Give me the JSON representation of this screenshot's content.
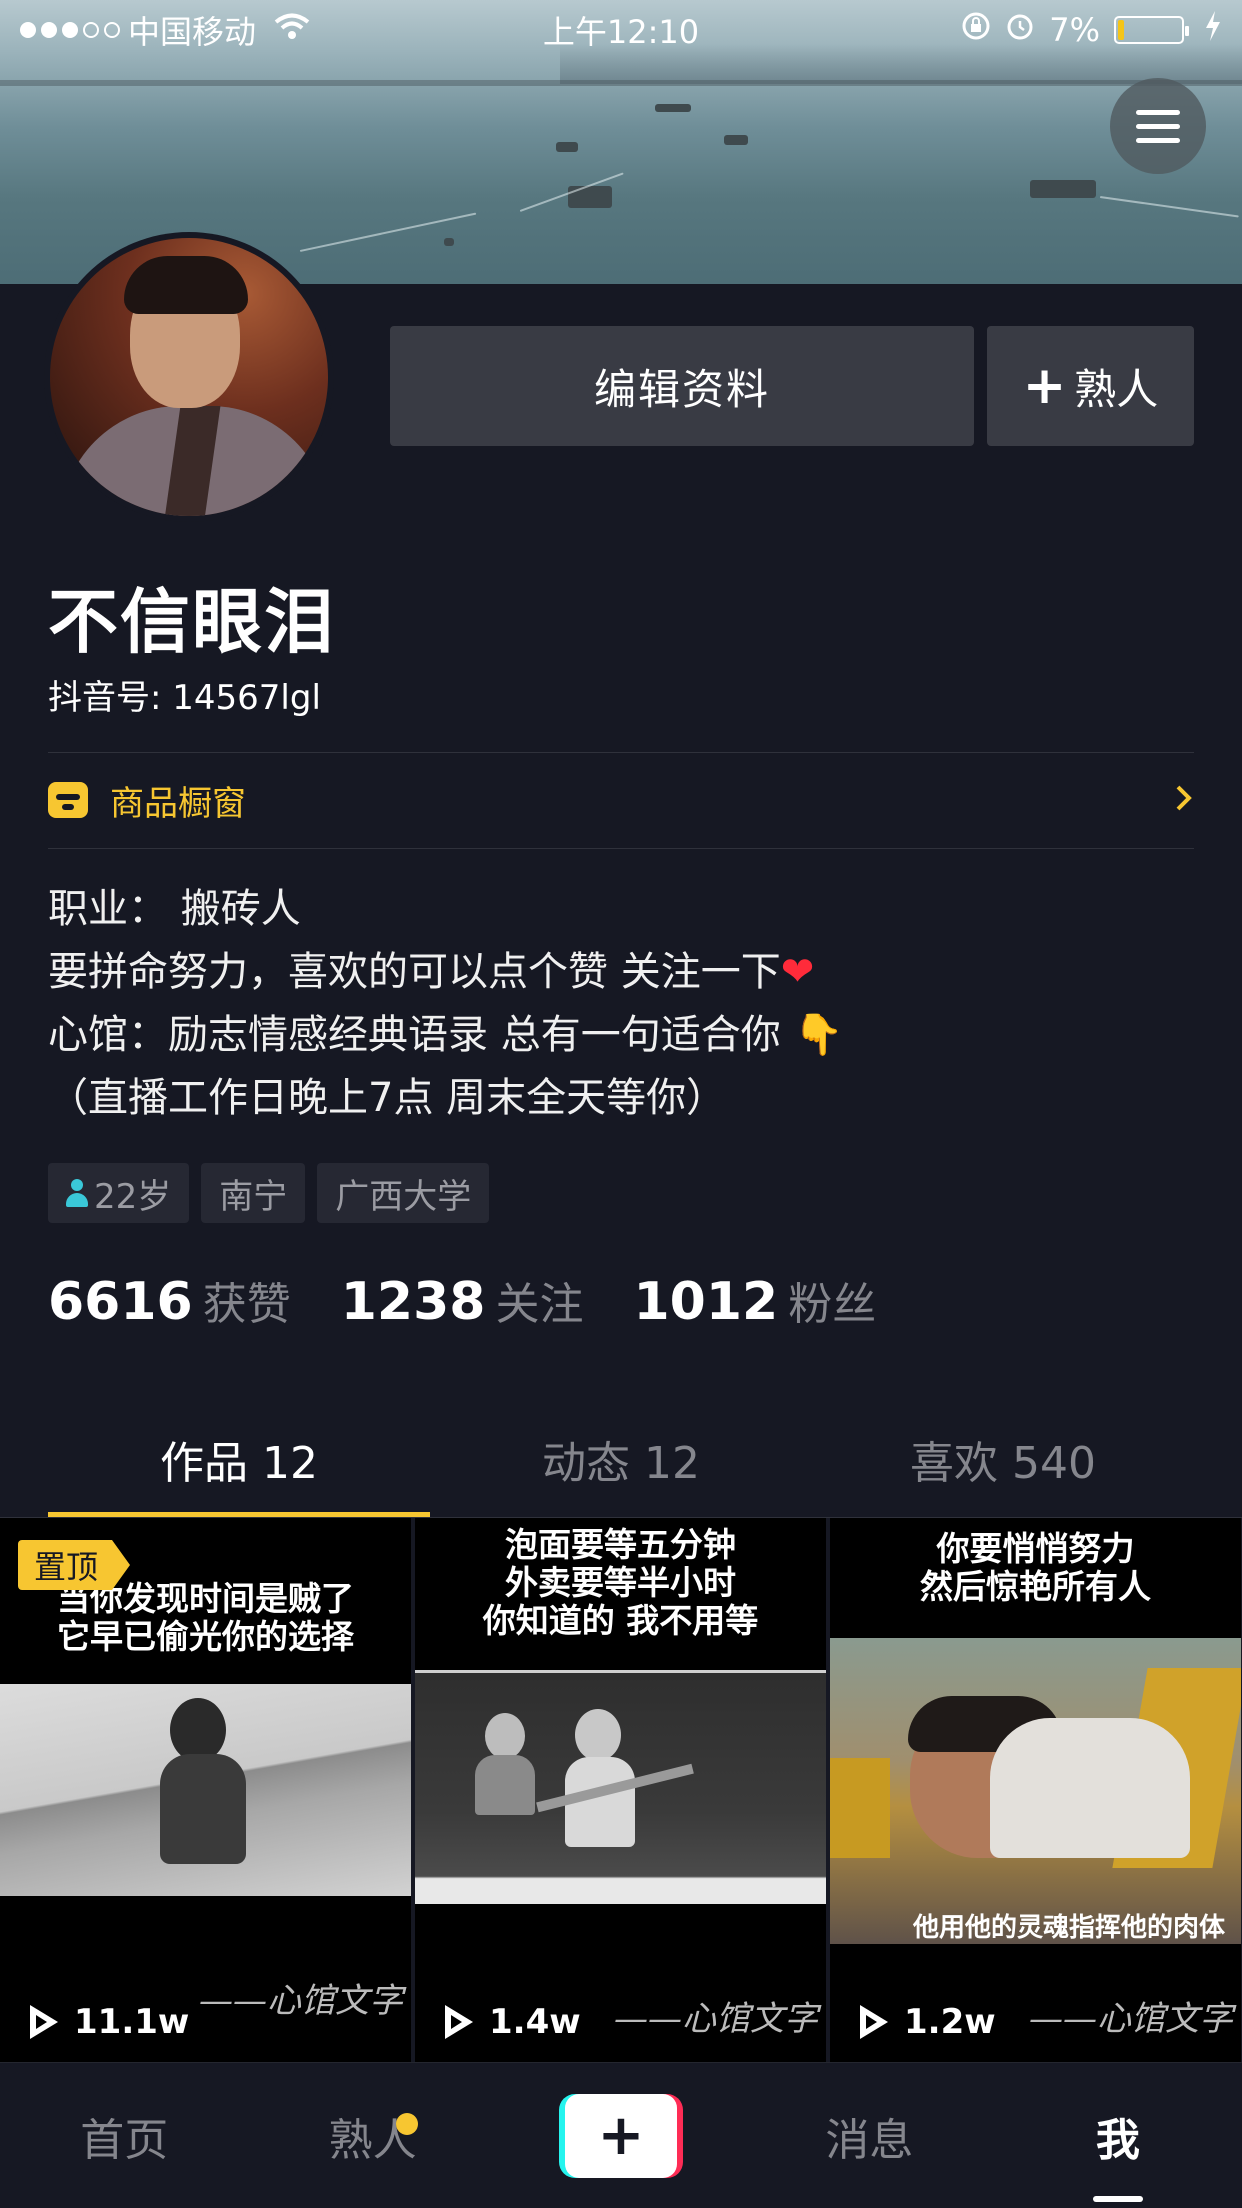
{
  "status_bar": {
    "carrier": "中国移动",
    "time": "上午12:10",
    "battery": "7%",
    "battery_level_fraction": 0.07
  },
  "header": {
    "menu_icon": "hamburger-menu-icon"
  },
  "profile": {
    "edit_button": "编辑资料",
    "add_friend_button": "熟人",
    "name": "不信眼泪",
    "douyin_id": "抖音号: 14567lgl",
    "shop_label": "商品橱窗",
    "bio_lines": [
      "职业：  搬砖人",
      "要拼命努力，喜欢的可以点个赞 关注一下",
      "心馆：励志情感经典语录 总有一句适合你",
      "（直播工作日晚上7点 周末全天等你）"
    ],
    "bio_emoji": {
      "heart": "❤",
      "pointer": "👇"
    },
    "tags": [
      "22岁",
      "南宁",
      "广西大学"
    ],
    "stats": [
      {
        "num": "6616",
        "label": "获赞"
      },
      {
        "num": "1238",
        "label": "关注"
      },
      {
        "num": "1012",
        "label": "粉丝"
      }
    ]
  },
  "tabs": [
    "作品 12",
    "动态 12",
    "喜欢 540"
  ],
  "videos": [
    {
      "pinned_label": "置顶",
      "caption": [
        "当你发现时间是贼了",
        "它早已偷光你的选择"
      ],
      "plays": "11.1w",
      "watermark": "——心馆文字"
    },
    {
      "caption": [
        "泡面要等五分钟",
        "外卖要等半小时",
        "你知道的 我不用等"
      ],
      "plays": "1.4w",
      "watermark": "——心馆文字"
    },
    {
      "caption": [
        "你要悄悄努力",
        "然后惊艳所有人"
      ],
      "subtitle": "他用他的灵魂指挥他的肉体",
      "plays": "1.2w",
      "watermark": "——心馆文字"
    }
  ],
  "bottom_nav": {
    "home": "首页",
    "friends": "熟人",
    "add": "+",
    "messages": "消息",
    "me": "我"
  },
  "colors": {
    "background": "#161823",
    "accent_yellow": "#f7c631",
    "button_bg": "#393b44",
    "muted_text": "#85868d"
  }
}
